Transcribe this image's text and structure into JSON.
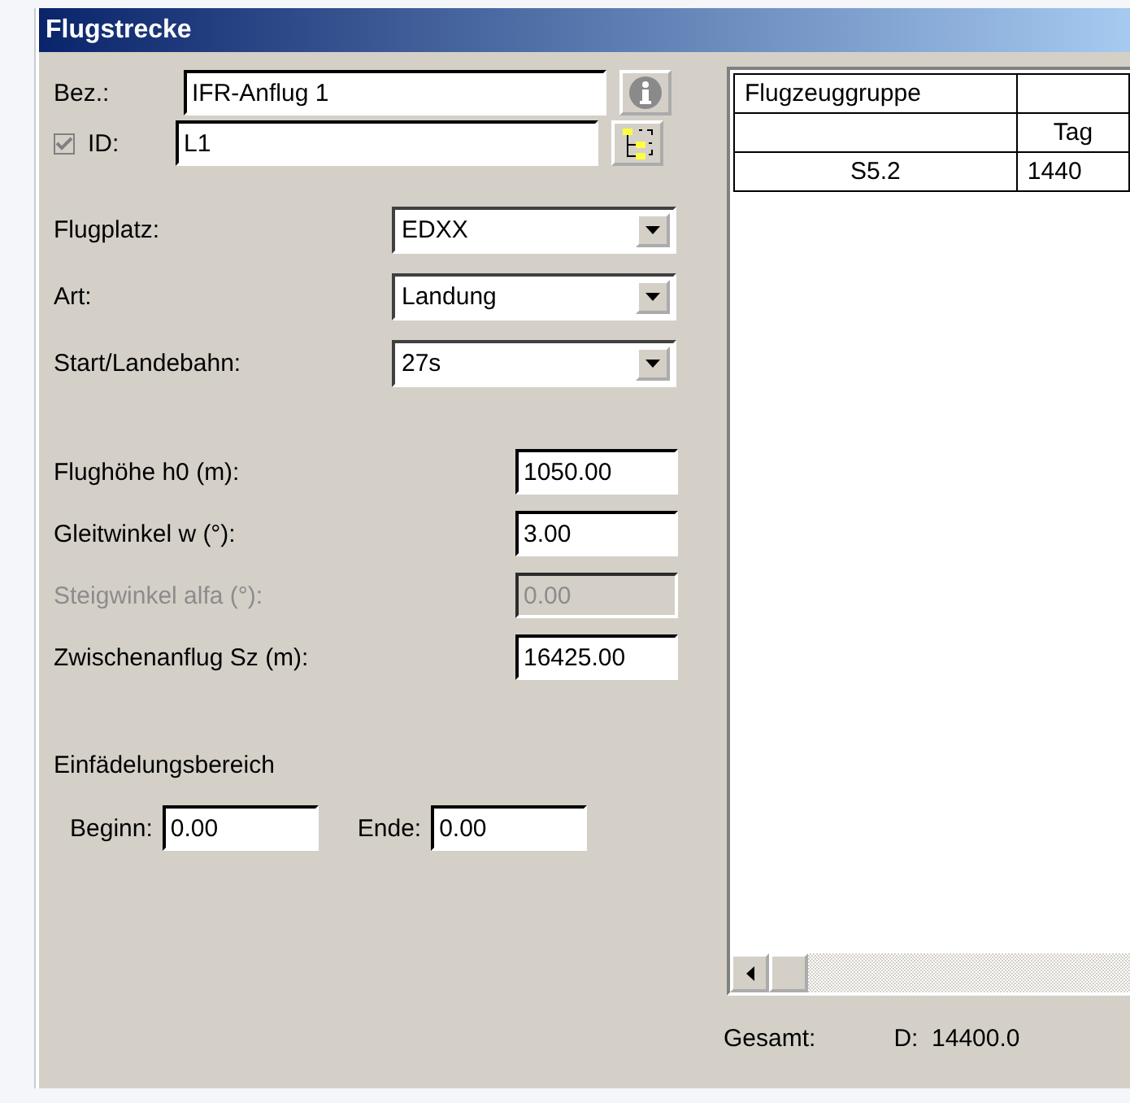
{
  "window": {
    "title": "Flugstrecke"
  },
  "name_field": {
    "label": "Bez.:",
    "value": "IFR-Anflug 1"
  },
  "id_field": {
    "label": "ID:",
    "value": "L1",
    "checked": true,
    "disabled": true
  },
  "dropdowns": [
    {
      "label": "Flugplatz:",
      "value": "EDXX"
    },
    {
      "label": "Art:",
      "value": "Landung"
    },
    {
      "label": "Start/Landebahn:",
      "value": "27s"
    }
  ],
  "number_fields": [
    {
      "label": "Flughöhe h0 (m):",
      "value": "1050.00",
      "disabled": false
    },
    {
      "label": "Gleitwinkel w (°):",
      "value": "3.00",
      "disabled": false
    },
    {
      "label": "Steigwinkel alfa (°):",
      "value": "0.00",
      "disabled": true
    },
    {
      "label": "Zwischenanflug Sz (m):",
      "value": "16425.00",
      "disabled": false
    }
  ],
  "merge_area": {
    "title": "Einfädelungsbereich",
    "fields": [
      {
        "label": "Beginn:",
        "value": "0.00"
      },
      {
        "label": "Ende:",
        "value": "0.00"
      }
    ]
  },
  "table": {
    "header": {
      "column_1": "Flugzeuggruppe"
    },
    "subheader": {
      "column_2": "Tag"
    },
    "rows": [
      [
        "S5.2",
        "1440"
      ]
    ]
  },
  "summary": {
    "label": "Gesamt:",
    "value": "D:  14400.0"
  }
}
